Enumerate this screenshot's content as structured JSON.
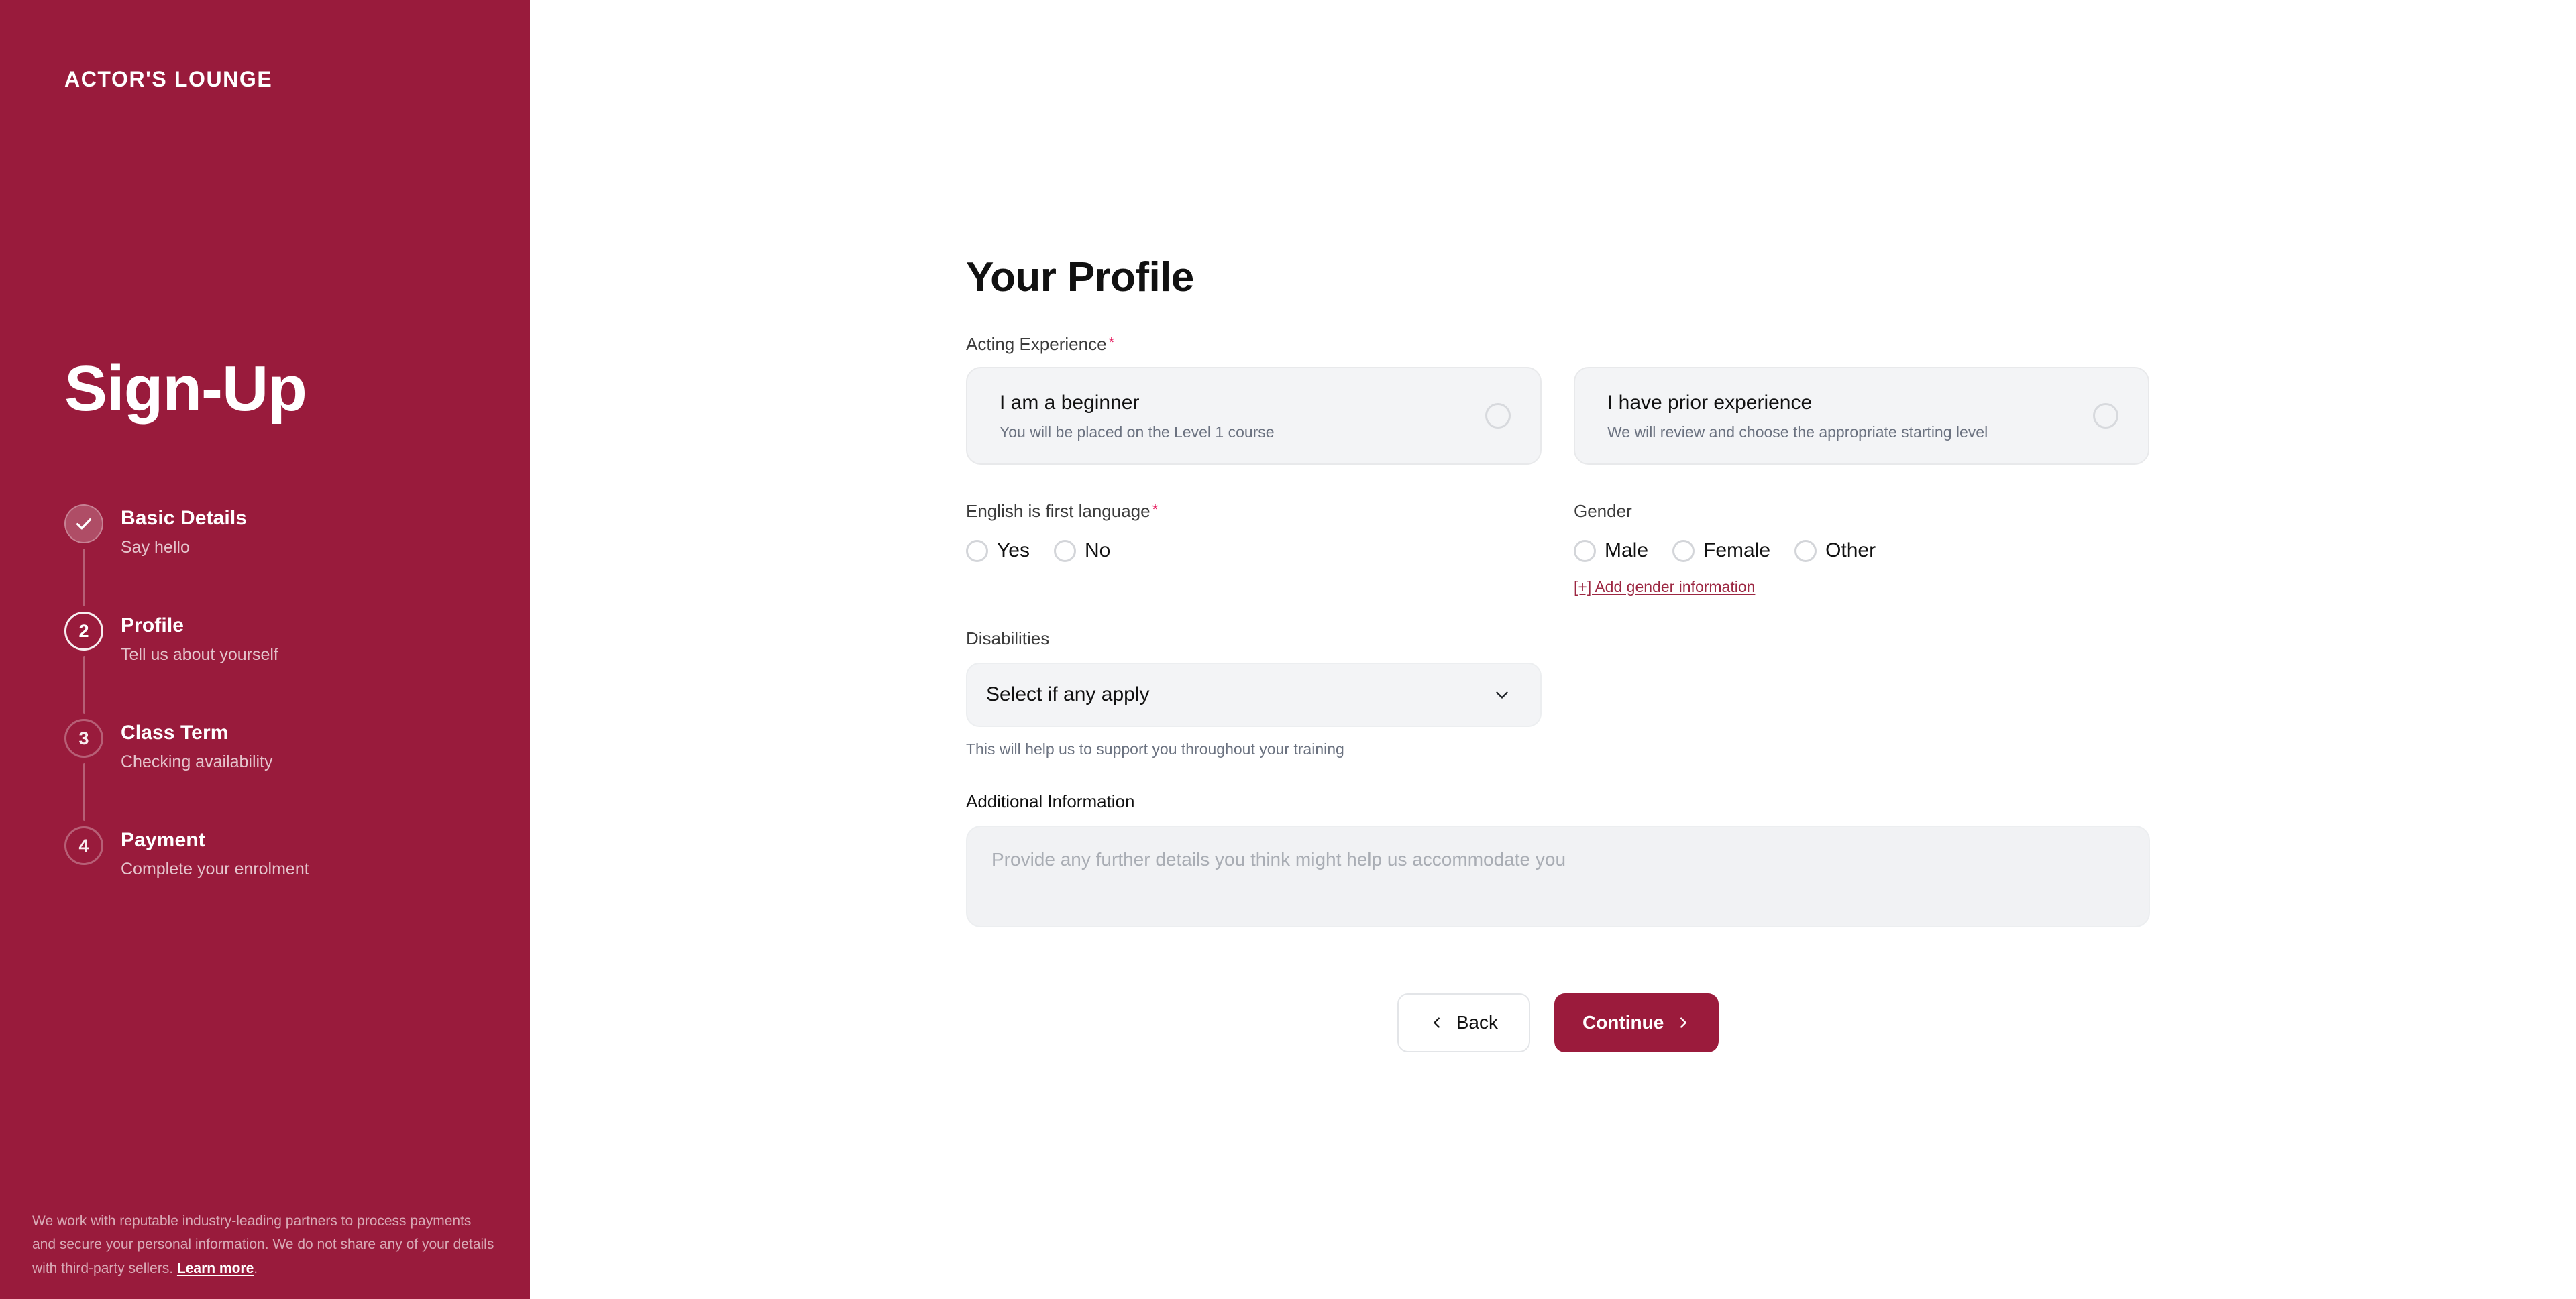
{
  "brand": {
    "name": "ACTOR'S LOUNGE",
    "accent_color": "#9B1B3C",
    "required_color": "#e5175b",
    "link_color": "#9c2742"
  },
  "sidebar": {
    "heading": "Sign-Up",
    "steps": [
      {
        "marker": "✓",
        "state": "done",
        "title": "Basic Details",
        "subtitle": "Say hello"
      },
      {
        "marker": "2",
        "state": "active",
        "title": "Profile",
        "subtitle": "Tell us about yourself"
      },
      {
        "marker": "3",
        "state": "todo",
        "title": "Class Term",
        "subtitle": "Checking availability"
      },
      {
        "marker": "4",
        "state": "todo",
        "title": "Payment",
        "subtitle": "Complete your enrolment"
      }
    ],
    "footer": {
      "text": "We work with reputable industry-leading partners to process payments and secure your personal information. We do not share any of your details with third-party sellers. ",
      "link_label": "Learn more",
      "trailing": "."
    }
  },
  "main": {
    "page_title": "Your Profile",
    "acting_experience": {
      "label": "Acting Experience",
      "required": "*",
      "options": [
        {
          "title": "I am a beginner",
          "subtitle": "You will be placed on the Level 1 course",
          "selected": "false"
        },
        {
          "title": "I have prior experience",
          "subtitle": "We will review and choose the appropriate starting level",
          "selected": "false"
        }
      ]
    },
    "english_first_language": {
      "label": "English is first language",
      "required": "*",
      "options": [
        "Yes",
        "No"
      ]
    },
    "gender": {
      "label": "Gender",
      "options": [
        "Male",
        "Female",
        "Other"
      ],
      "add_link": "[+] Add gender information"
    },
    "disabilities": {
      "label": "Disabilities",
      "value": "Select if any apply",
      "helper": "This will help us to support you throughout your training"
    },
    "additional_information": {
      "label": "Additional Information",
      "placeholder": "Provide any further details you think might help us accommodate you",
      "value": ""
    },
    "actions": {
      "back_label": "Back",
      "continue_label": "Continue"
    }
  }
}
